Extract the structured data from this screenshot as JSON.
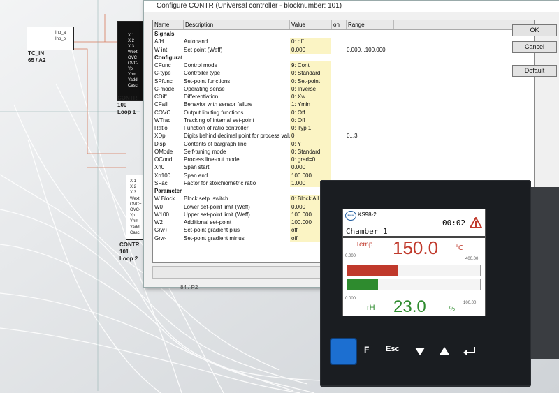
{
  "blocks": {
    "tc_in": {
      "label": "TC_IN",
      "sub": "65 / A2",
      "ports_in": [
        "Fail_b",
        "Fail_a",
        "Inp_a",
        "Inp_b"
      ]
    },
    "contr1": {
      "num": "100",
      "name": "CONTR",
      "loop": "Loop 1"
    },
    "contr2": {
      "num": "101",
      "name": "CONTR",
      "loop": "Loop 2"
    },
    "p2": {
      "label": "84 / P2"
    },
    "ports": [
      "X 1",
      "X 2",
      "X 3",
      "Wext",
      "OVC+",
      "OVC-",
      "Yp",
      "Yhm",
      "Yadd",
      "Casc"
    ]
  },
  "dialog": {
    "title": "Configure CONTR (Universal controller - blocknumber: 101)",
    "headers": {
      "name": "Name",
      "desc": "Description",
      "value": "Value",
      "on": "on",
      "range": "Range"
    },
    "buttons": {
      "ok": "OK",
      "cancel": "Cancel",
      "default": "Default"
    },
    "rows": [
      {
        "name": "Signals",
        "desc": "",
        "value": "",
        "range": "",
        "section": true
      },
      {
        "name": "A/H",
        "desc": "Autohand",
        "value": "0: off",
        "range": ""
      },
      {
        "name": "W int",
        "desc": "Set point (Weff)",
        "value": "0.000",
        "range": "0.000...100.000"
      },
      {
        "name": "Configurations",
        "desc": "",
        "value": "",
        "range": "",
        "section": true
      },
      {
        "name": "CFunc",
        "desc": "Control mode",
        "value": "9: Cont",
        "range": ""
      },
      {
        "name": "C-type",
        "desc": "Controller type",
        "value": "0: Standard",
        "range": ""
      },
      {
        "name": "SPfunc",
        "desc": "Set-point functions",
        "value": "0: Set-point",
        "range": ""
      },
      {
        "name": "C-mode",
        "desc": "Operating sense",
        "value": "0: Inverse",
        "range": ""
      },
      {
        "name": "CDiff",
        "desc": "Differentiation",
        "value": "0: Xw",
        "range": ""
      },
      {
        "name": "CFail",
        "desc": "Behavior with sensor failure",
        "value": "1: Ymin",
        "range": ""
      },
      {
        "name": "COVC",
        "desc": "Output limiting functions",
        "value": "0: Off",
        "range": ""
      },
      {
        "name": "WTrac",
        "desc": "Tracking of internal set-point",
        "value": "0: Off",
        "range": ""
      },
      {
        "name": "Ratio",
        "desc": "Function of ratio controller",
        "value": "0: Typ 1",
        "range": ""
      },
      {
        "name": "XDp",
        "desc": "Digits behind decimal point for process valu",
        "value": "0",
        "range": "0...3"
      },
      {
        "name": "Disp",
        "desc": "Contents of bargraph line",
        "value": "0: Y",
        "range": ""
      },
      {
        "name": "OMode",
        "desc": "Self-tuning mode",
        "value": "0: Standard",
        "range": ""
      },
      {
        "name": "OCond",
        "desc": "Process line-out mode",
        "value": "0: grad=0",
        "range": ""
      },
      {
        "name": "Xn0",
        "desc": "Span start",
        "value": "0.000",
        "range": ""
      },
      {
        "name": "Xn100",
        "desc": "Span end",
        "value": "100.000",
        "range": ""
      },
      {
        "name": "SFac",
        "desc": "Factor for stoichiometric ratio",
        "value": "1.000",
        "range": ""
      },
      {
        "name": "Parameter",
        "desc": "",
        "value": "",
        "range": "",
        "section": true
      },
      {
        "name": "W Block",
        "desc": "Block setp. switch",
        "value": "0: Block All",
        "range": ""
      },
      {
        "name": "W0",
        "desc": "Lower set-point limit (Weff)",
        "value": "0.000",
        "range": ""
      },
      {
        "name": "W100",
        "desc": "Upper set-point limit (Weff)",
        "value": "100.000",
        "range": ""
      },
      {
        "name": "W2",
        "desc": "Additional set-point",
        "value": "100.000",
        "range": ""
      },
      {
        "name": "Grw+",
        "desc": "Set-point gradient plus",
        "value": "off",
        "range": ""
      },
      {
        "name": "Grw-",
        "desc": "Set-point gradient minus",
        "value": "off",
        "range": ""
      }
    ]
  },
  "device": {
    "model": "KS98-2",
    "brand_badge": "PMA",
    "time": "00:02",
    "title": "Chamber 1",
    "pv": {
      "label": "Temp",
      "value": "150.0",
      "unit": "°C",
      "min": "0.000",
      "max": "400.00",
      "fraction": 0.38
    },
    "sv": {
      "label": "rH",
      "value": "23.0",
      "unit": "%",
      "min": "0.000",
      "max": "100.00",
      "fraction": 0.23
    },
    "keys": {
      "f": "F",
      "esc": "Esc"
    },
    "colors": {
      "pv": "#c0392b",
      "sv": "#2e8b2e",
      "f_key": "#1c6fd1"
    }
  }
}
